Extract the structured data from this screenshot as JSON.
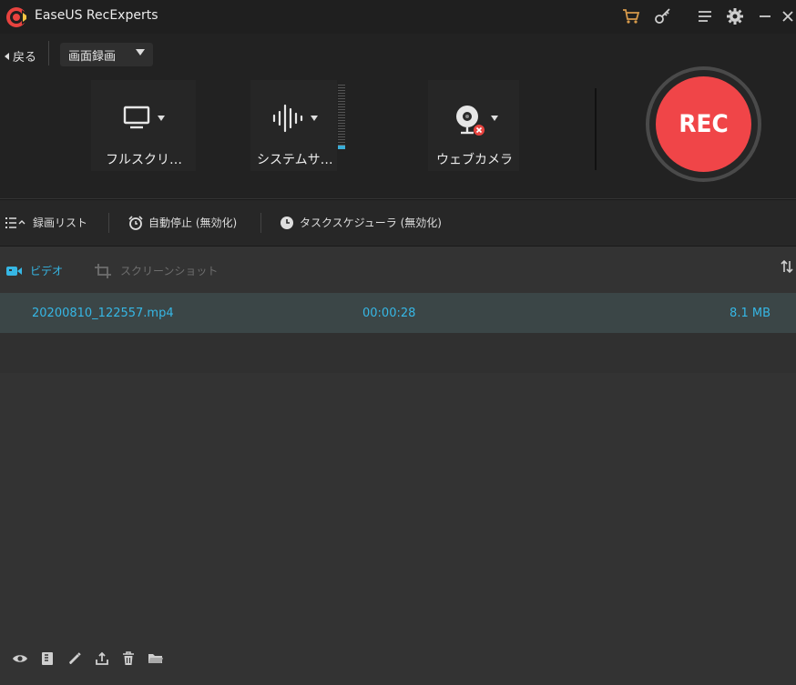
{
  "app": {
    "title": "EaseUS RecExperts"
  },
  "titlebar_icons": [
    "cart-icon",
    "key-icon",
    "menu-icon",
    "settings-icon",
    "minimize-icon",
    "close-icon"
  ],
  "toolbar": {
    "back_label": "戻る",
    "mode_label": "画面録画",
    "sources": {
      "screen": "フルスクリ…",
      "audio": "システムサ…",
      "webcam": "ウェブカメラ"
    },
    "rec_label": "REC"
  },
  "subbar": {
    "recording_list": "録画リスト",
    "auto_stop": "自動停止 (無効化)",
    "task_scheduler": "タスクスケジューラ (無効化)"
  },
  "tabs": {
    "video": "ビデオ",
    "screenshot": "スクリーンショット"
  },
  "recordings": [
    {
      "name": "20200810_122557.mp4",
      "duration": "00:00:28",
      "size": "8.1 MB"
    }
  ],
  "bottom_icons": [
    "preview-icon",
    "clip-icon",
    "edit-icon",
    "share-icon",
    "delete-icon",
    "folder-icon"
  ],
  "colors": {
    "accent": "#36b7e5",
    "rec": "#f04548",
    "logo": "#e8433f"
  }
}
